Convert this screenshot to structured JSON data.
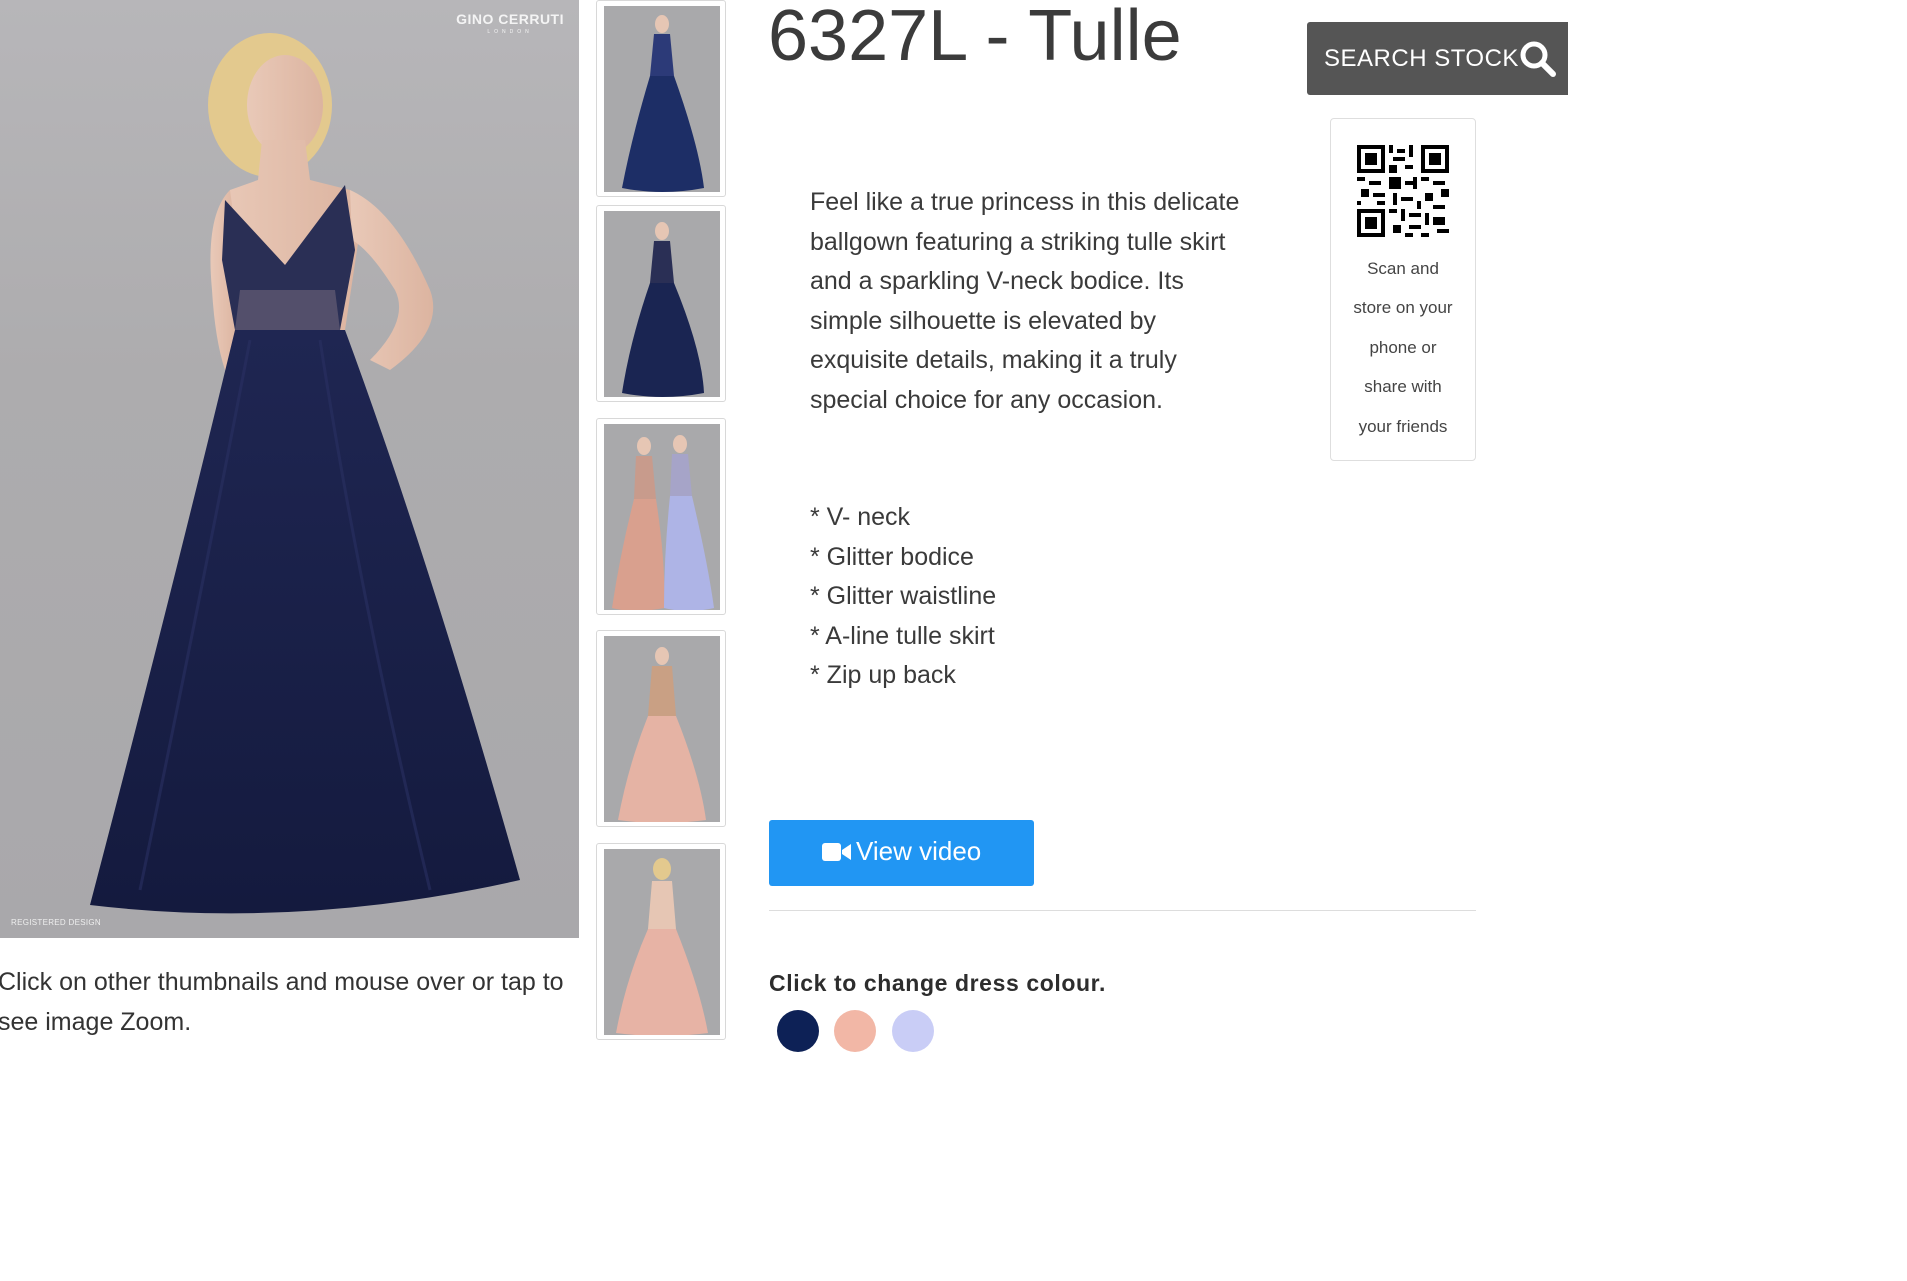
{
  "brand": {
    "name": "GINO CERRUTI",
    "sub": "LONDON",
    "registered": "REGISTERED DESIGN"
  },
  "main_image": {
    "alt": "Navy tulle ballgown"
  },
  "zoom_hint": "Click on other thumbnails and mouse over or tap to see image Zoom.",
  "thumbnails": [
    {
      "dress_color": "#1d2e66"
    },
    {
      "dress_color": "#1a2552"
    },
    {
      "dress_color": "#d9a08e",
      "second_color": "#aeb4e6"
    },
    {
      "dress_color": "#e5b3a4"
    },
    {
      "dress_color": "#e7b3a5"
    }
  ],
  "product": {
    "title": "6327L - Tulle",
    "description": "Feel like a true princess in this delicate ballgown featuring a striking tulle skirt and a sparkling V-neck bodice. Its simple silhouette is elevated by exquisite details, making it a truly special choice for any occasion.",
    "features": [
      "* V- neck",
      "* Glitter bodice",
      "* Glitter waistline",
      "* A-line tulle skirt",
      "* Zip up back"
    ]
  },
  "search": {
    "label": "SEARCH STOCK",
    "icon": "search-icon"
  },
  "qr": {
    "icon": "qr-code",
    "lines": [
      "Scan and",
      "store on your",
      "phone or",
      "share with",
      "your friends"
    ]
  },
  "video": {
    "label": "View video",
    "icon": "video-camera-icon",
    "color": "#2196f3"
  },
  "colour_section": {
    "heading": "Click to change dress colour.",
    "swatches": [
      {
        "name": "navy",
        "color": "#0d2156"
      },
      {
        "name": "peach",
        "color": "#f2b7a6"
      },
      {
        "name": "lilac",
        "color": "#c9cdf6"
      }
    ]
  }
}
